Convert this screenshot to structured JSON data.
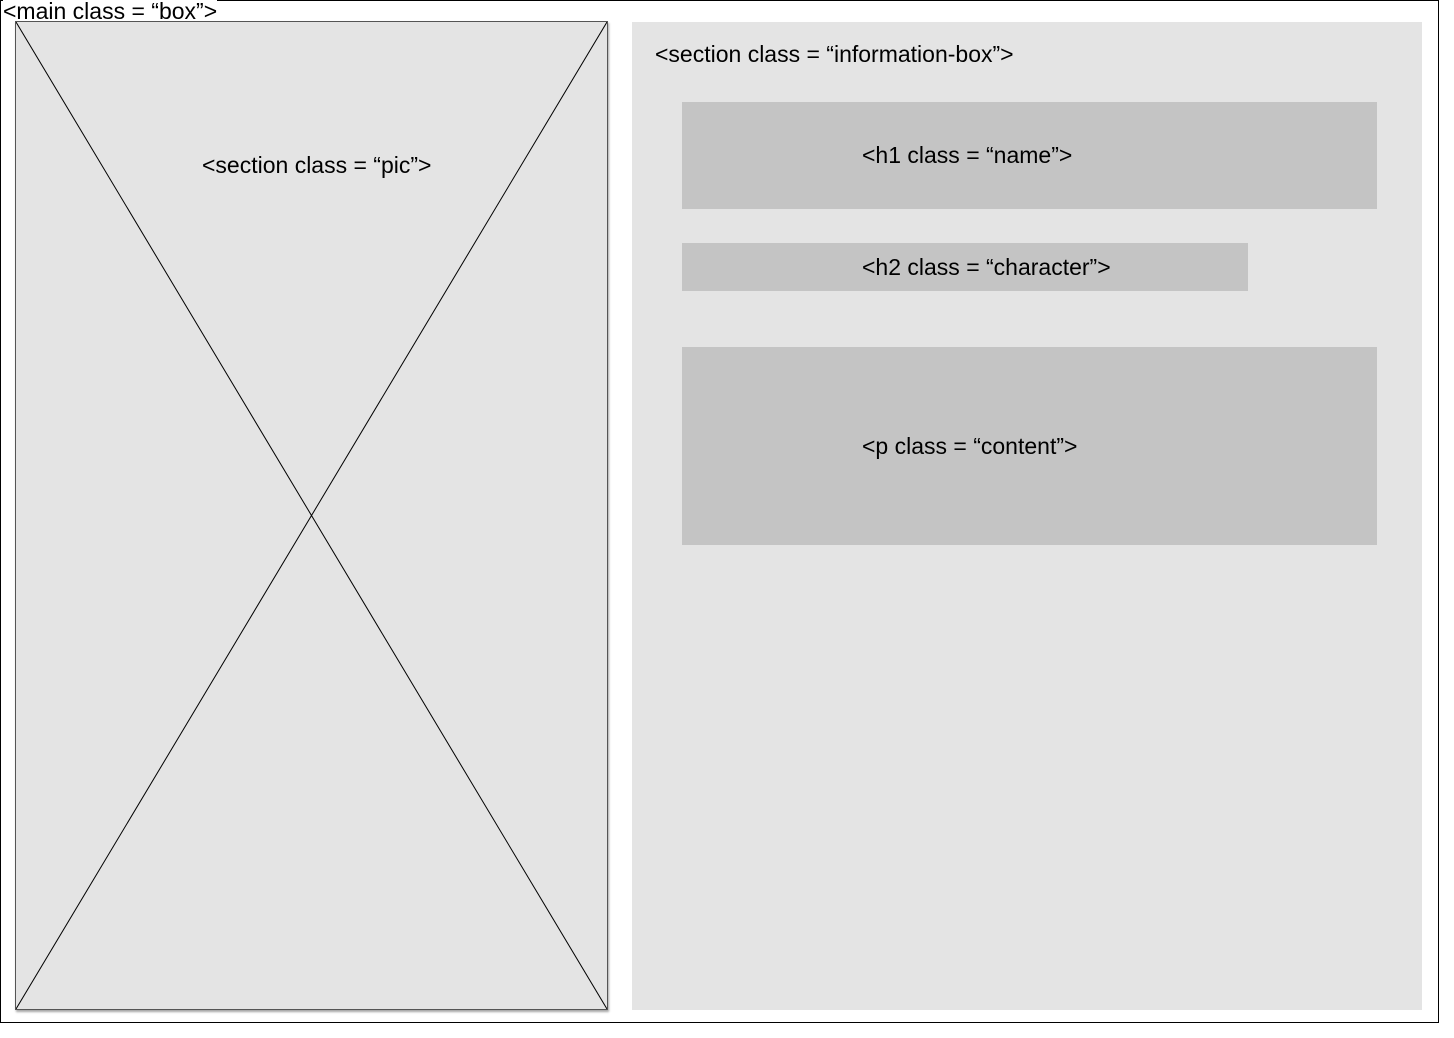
{
  "main": {
    "label": "<main class = “box”>"
  },
  "pic": {
    "label": "<section class = “pic”>",
    "placeholder": "image-placeholder-cross"
  },
  "information_box": {
    "label": "<section class = “information-box”>",
    "name_label": "<h1 class = “name”>",
    "character_label": "<h2 class = “character”>",
    "content_label": "<p class = “content”>"
  },
  "colors": {
    "section_fill": "#e4e4e4",
    "block_fill": "#c4c4c4",
    "stroke": "#000000"
  }
}
